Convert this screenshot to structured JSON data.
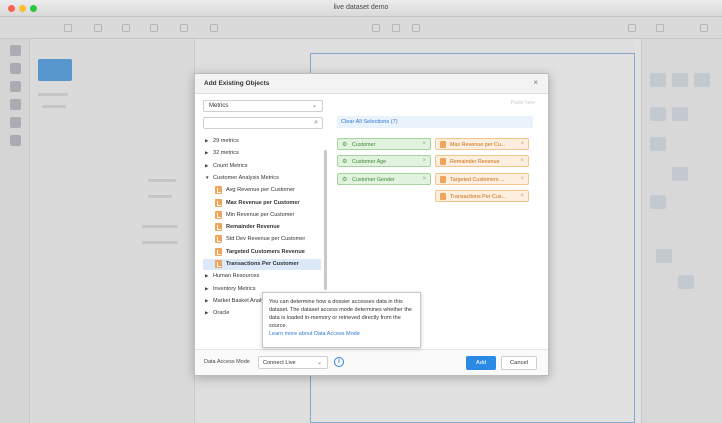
{
  "window": {
    "title": "live dataset demo"
  },
  "modal": {
    "title": "Add Existing Objects",
    "close_glyph": "×",
    "object_type": "Metrics",
    "search_placeholder": "",
    "paste_hint": "Paste here",
    "clear_selections": "Clear All Selections (7)",
    "tree": [
      {
        "label": "29 metrics",
        "expanded": false,
        "level": 0
      },
      {
        "label": "32 metrics",
        "expanded": false,
        "level": 0
      },
      {
        "label": "Count Metrics",
        "expanded": false,
        "level": 0
      },
      {
        "label": "Customer Analysis Metrics",
        "expanded": true,
        "level": 0
      },
      {
        "label": "Avg Revenue per Customer",
        "level": 1,
        "bold": false
      },
      {
        "label": "Max Revenue per Customer",
        "level": 1,
        "bold": true
      },
      {
        "label": "Min Revenue per Customer",
        "level": 1,
        "bold": false
      },
      {
        "label": "Remainder Revenue",
        "level": 1,
        "bold": true
      },
      {
        "label": "Std Dev Revenue per Customer",
        "level": 1,
        "bold": false
      },
      {
        "label": "Targeted Customers Revenue",
        "level": 1,
        "bold": true
      },
      {
        "label": "Transactions Per Customer",
        "level": 1,
        "bold": true,
        "selected": true
      },
      {
        "label": "Human Resources",
        "expanded": false,
        "level": 0
      },
      {
        "label": "Inventory Metrics",
        "expanded": false,
        "level": 0
      },
      {
        "label": "Market Basket Analysis",
        "expanded": false,
        "level": 0
      },
      {
        "label": "Oracle",
        "expanded": false,
        "level": 0
      }
    ],
    "selected_attributes": [
      "Customer",
      "Customer Age",
      "Customer Gender"
    ],
    "selected_metrics": [
      "Max Revenue per Cu...",
      "Remainder Revenue",
      "Targeted Customers ...",
      "Transactions Per Cus..."
    ],
    "chip_remove_glyph": "×",
    "footer": {
      "data_access_label": "Data Access Mode",
      "data_access_value": "Connect Live",
      "info_glyph": "i",
      "add_label": "Add",
      "cancel_label": "Cancel"
    }
  },
  "tooltip": {
    "text": "You can determine how a dossier accesses data in this dataset. The dataset access mode determines whether the data is loaded in-memory or retrieved directly from the source.",
    "link": "Learn more about Data Access Mode"
  },
  "colors": {
    "accent": "#2b8ae6",
    "attribute_chip": "#e1f2df",
    "metric_chip": "#fdefdf",
    "metric_icon": "#f1a55a"
  },
  "icons": {
    "caret_collapsed": "▶",
    "caret_expanded": "▼",
    "search": "search-icon",
    "attribute": "attribute-icon",
    "metric": "metric-icon",
    "dropdown": "chevron-down-icon"
  }
}
